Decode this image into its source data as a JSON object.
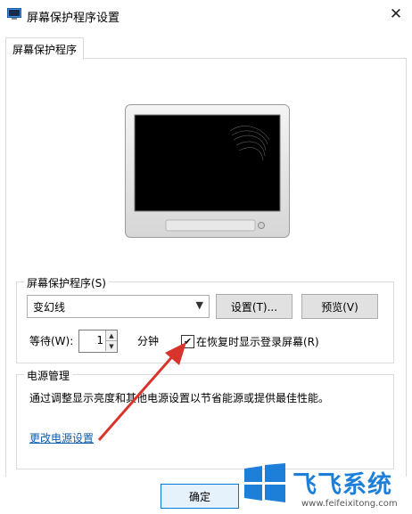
{
  "window": {
    "title": "屏幕保护程序设置",
    "close_glyph": "✕"
  },
  "tab": {
    "label": "屏幕保护程序"
  },
  "screensaver": {
    "group_label": "屏幕保护程序(S)",
    "selected": "变幻线",
    "settings_button": "设置(T)...",
    "preview_button": "预览(V)",
    "wait_label": "等待(W):",
    "wait_value": "1",
    "wait_unit": "分钟",
    "resume_checkbox": {
      "label": "在恢复时显示登录屏幕(R)",
      "checked": true,
      "check_glyph": "✔"
    }
  },
  "power": {
    "group_label": "电源管理",
    "description": "通过调整显示亮度和其他电源设置以节省能源或提供最佳性能。",
    "link": "更改电源设置"
  },
  "footer": {
    "ok_button": "确定"
  },
  "watermark": {
    "brand": "飞飞系统",
    "url": "www.feifeixitong.com"
  },
  "colors": {
    "link": "#0b5eaf",
    "annotation_arrow": "#d9342b",
    "watermark_blue": "#1e7fd9"
  }
}
